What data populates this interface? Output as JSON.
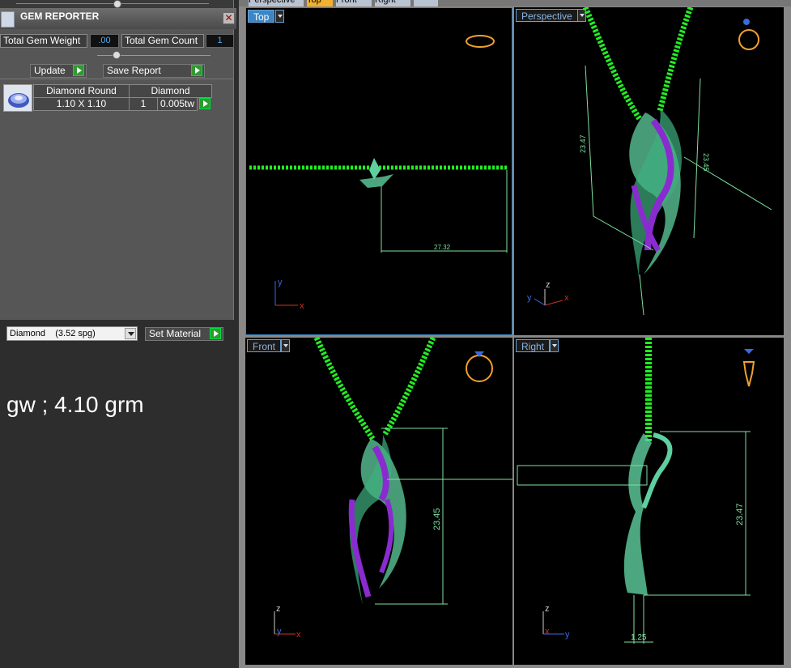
{
  "gem_reporter": {
    "title": "GEM REPORTER",
    "total_gem_weight_label": "Total Gem Weight",
    "total_gem_weight_value": ".00",
    "total_gem_count_label": "Total Gem Count",
    "total_gem_count_value": "1",
    "update_label": "Update",
    "save_report_label": "Save Report",
    "table": {
      "col1_header": "Diamond Round",
      "col2_header": "Diamond",
      "size": "1.10 X 1.10",
      "count": "1",
      "weight": "0.005tw"
    }
  },
  "material": {
    "selected": "Diamond    (3.52 spg)",
    "set_material_label": "Set Material"
  },
  "note": "gw ; 4.10 grm",
  "viewport_tabs": [
    "Perspective",
    "Top",
    "Front",
    "Right"
  ],
  "viewports": {
    "top": {
      "label": "Top",
      "dimension": "27.32"
    },
    "perspective": {
      "label": "Perspective",
      "dim_left": "23.47",
      "dim_right": "23.45"
    },
    "front": {
      "label": "Front",
      "dimension": "23.45"
    },
    "right": {
      "label": "Right",
      "dim_height": "23.47",
      "dim_width": "1.25"
    }
  },
  "axes": {
    "x": "x",
    "y": "y",
    "z": "z"
  },
  "colors": {
    "chain": "#22ee22",
    "pendant": "#5fcf9f",
    "gems": "#8a2bd0",
    "dimension": "#7fe0a0",
    "ring_icon": "#f0a030"
  }
}
